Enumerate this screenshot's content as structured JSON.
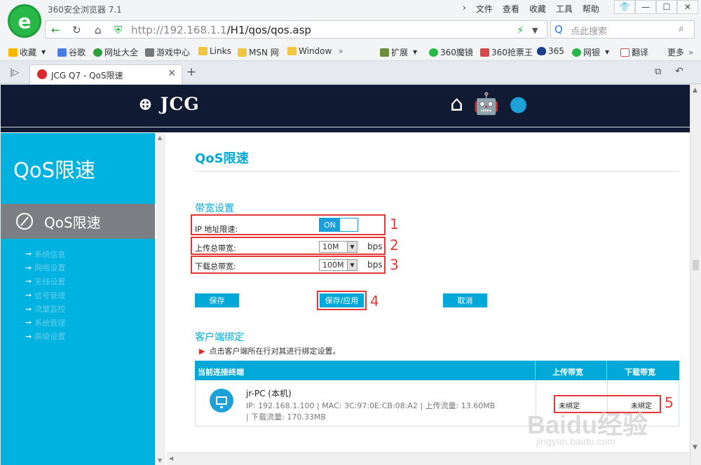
{
  "browser": {
    "title": "360安全浏览器 7.1",
    "menu": [
      "文件",
      "查看",
      "收藏",
      "工具",
      "帮助"
    ],
    "url_host": "http://192.168.1.1",
    "url_path": "/H1/qos/qos.asp",
    "search_placeholder": "点此搜索",
    "bookmarks": [
      "收藏",
      "谷歌",
      "网址大全",
      "游戏中心",
      "Links",
      "MSN 网",
      "Window",
      "扩展",
      "360魔镜",
      "360抢票王",
      "365",
      "网银",
      "翻译",
      "更多"
    ],
    "tab_title": "JCG Q7 - QoS限速"
  },
  "banner": {
    "brand": "JCG"
  },
  "sidebar": {
    "title": "QoS限速",
    "active": "QoS限速",
    "items": [
      "系统信息",
      "网络设置",
      "无线设置",
      "信号管理",
      "流量监控",
      "系统管理",
      "高级设置"
    ]
  },
  "main": {
    "heading": "QoS限速",
    "bandwidth_section": "带宽设置",
    "ip_limit_label": "IP 地址限速:",
    "toggle_state": "ON",
    "upload_label": "上传总带宽:",
    "upload_value": "10M",
    "download_label": "下载总带宽:",
    "download_value": "100M",
    "unit": "bps",
    "buttons": {
      "save": "保存",
      "save_apply": "保存/应用",
      "cancel": "取消"
    },
    "binding_section": "客户端绑定",
    "tip": "点击客户端所在行对其进行绑定设置。",
    "table": {
      "col_device": "当前连接终端",
      "col_upload": "上传带宽",
      "col_download": "下载带宽",
      "row": {
        "name": "jr-PC (本机)",
        "info_line1": "IP: 192.168.1.100   |   MAC: 3C:97:0E:CB:08:A2   |   上传流量: 13.60MB",
        "info_line2": "|   下载流量: 170.33MB",
        "upload_bind": "未绑定",
        "download_bind": "未绑定"
      }
    }
  },
  "annotations": [
    "1",
    "2",
    "3",
    "4",
    "5"
  ],
  "watermark": {
    "text": "Baidu经验",
    "sub": "jingyan.baidu.com"
  }
}
